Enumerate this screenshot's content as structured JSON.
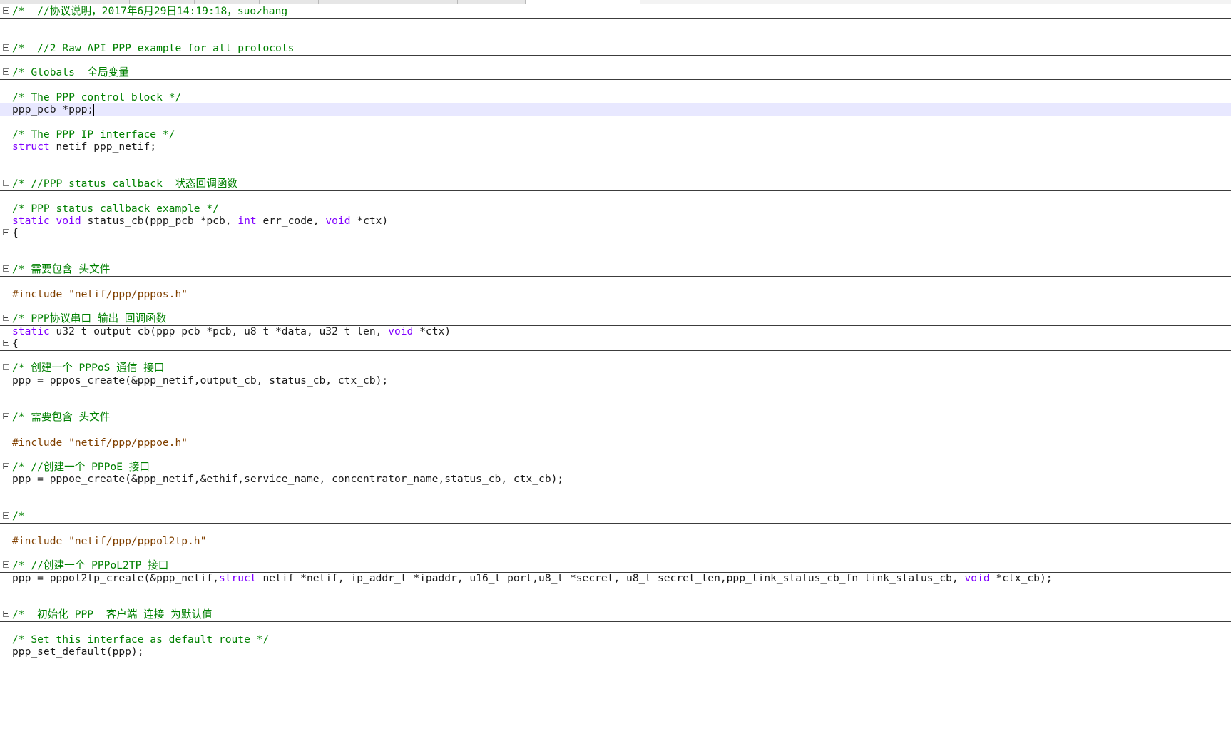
{
  "colors": {
    "comment": "#008000",
    "keyword": "#8000ff",
    "preprocessor": "#804000",
    "text": "#1a1a1a",
    "current_line": "#e8e8ff"
  },
  "icons": {
    "fold": "fold-expand-icon"
  },
  "editor": {
    "lines": [
      {
        "fold": true,
        "folded": true,
        "tokens": [
          {
            "t": "comment",
            "v": "/*  //协议说明，2017年6月29日14:19:18，suozhang"
          }
        ]
      },
      {
        "fold": true,
        "folded": true,
        "tokens": [
          {
            "t": "comment",
            "v": "/*  //2 Raw API PPP example for all protocols"
          }
        ]
      },
      {
        "fold": true,
        "folded": true,
        "tokens": [
          {
            "t": "comment",
            "v": "/* Globals  全局变量"
          }
        ]
      },
      {
        "tokens": [
          {
            "t": "comment",
            "v": "/* The PPP control block */"
          }
        ]
      },
      {
        "current": true,
        "tokens": [
          {
            "t": "plain",
            "v": "ppp_pcb *ppp;"
          }
        ]
      },
      {
        "tokens": [
          {
            "t": "comment",
            "v": "/* The PPP IP interface */"
          }
        ]
      },
      {
        "tokens": [
          {
            "t": "kw",
            "v": "struct"
          },
          {
            "t": "plain",
            "v": " netif ppp_netif;"
          }
        ]
      },
      {
        "fold": true,
        "folded": true,
        "tokens": [
          {
            "t": "comment",
            "v": "/* //PPP status callback  状态回调函数"
          }
        ]
      },
      {
        "tokens": [
          {
            "t": "comment",
            "v": "/* PPP status callback example */"
          }
        ]
      },
      {
        "tokens": [
          {
            "t": "kw",
            "v": "static"
          },
          {
            "t": "plain",
            "v": " "
          },
          {
            "t": "kw",
            "v": "void"
          },
          {
            "t": "plain",
            "v": " status_cb(ppp_pcb *pcb, "
          },
          {
            "t": "kw",
            "v": "int"
          },
          {
            "t": "plain",
            "v": " err_code, "
          },
          {
            "t": "kw",
            "v": "void"
          },
          {
            "t": "plain",
            "v": " *ctx)"
          }
        ]
      },
      {
        "fold": true,
        "folded": true,
        "tokens": [
          {
            "t": "plain",
            "v": "{"
          }
        ]
      },
      {
        "fold": true,
        "folded": true,
        "tokens": [
          {
            "t": "comment",
            "v": "/* 需要包含 头文件"
          }
        ]
      },
      {
        "tokens": [
          {
            "t": "pre",
            "v": "#include \"netif/ppp/pppos.h\""
          }
        ]
      },
      {
        "fold": true,
        "folded": true,
        "tokens": [
          {
            "t": "comment",
            "v": "/* PPP协议串口 输出 回调函数"
          }
        ]
      },
      {
        "tokens": [
          {
            "t": "kw",
            "v": "static"
          },
          {
            "t": "plain",
            "v": " u32_t output_cb(ppp_pcb *pcb, u8_t *data, u32_t len, "
          },
          {
            "t": "kw",
            "v": "void"
          },
          {
            "t": "plain",
            "v": " *ctx)"
          }
        ]
      },
      {
        "fold": true,
        "folded": true,
        "tokens": [
          {
            "t": "plain",
            "v": "{"
          }
        ]
      },
      {
        "fold": true,
        "folded": false,
        "tokens": [
          {
            "t": "comment",
            "v": "/* 创建一个 PPPoS 通信 接口"
          }
        ]
      },
      {
        "tokens": [
          {
            "t": "plain",
            "v": "ppp = pppos_create(&ppp_netif,output_cb, status_cb, ctx_cb);"
          }
        ]
      },
      {
        "fold": true,
        "folded": true,
        "tokens": [
          {
            "t": "comment",
            "v": "/* 需要包含 头文件"
          }
        ]
      },
      {
        "tokens": [
          {
            "t": "pre",
            "v": "#include \"netif/ppp/pppoe.h\""
          }
        ]
      },
      {
        "fold": true,
        "folded": true,
        "tokens": [
          {
            "t": "comment",
            "v": "/* //创建一个 PPPoE 接口"
          }
        ]
      },
      {
        "tokens": [
          {
            "t": "plain",
            "v": "ppp = pppoe_create(&ppp_netif,&ethif,service_name, concentrator_name,status_cb, ctx_cb);"
          }
        ]
      },
      {
        "fold": true,
        "folded": true,
        "tokens": [
          {
            "t": "comment",
            "v": "/*"
          }
        ]
      },
      {
        "tokens": [
          {
            "t": "pre",
            "v": "#include \"netif/ppp/pppol2tp.h\""
          }
        ]
      },
      {
        "fold": true,
        "folded": true,
        "tokens": [
          {
            "t": "comment",
            "v": "/* //创建一个 PPPoL2TP 接口"
          }
        ]
      },
      {
        "tokens": [
          {
            "t": "plain",
            "v": "ppp = pppol2tp_create(&ppp_netif,"
          },
          {
            "t": "kw",
            "v": "struct"
          },
          {
            "t": "plain",
            "v": " netif *netif, ip_addr_t *ipaddr, u16_t port,u8_t *secret, u8_t secret_len,ppp_link_status_cb_fn link_status_cb, "
          },
          {
            "t": "kw",
            "v": "void"
          },
          {
            "t": "plain",
            "v": " *ctx_cb);"
          }
        ]
      },
      {
        "fold": true,
        "folded": true,
        "tokens": [
          {
            "t": "comment",
            "v": "/*  初始化 PPP  客户端 连接 为默认值"
          }
        ]
      },
      {
        "tokens": [
          {
            "t": "comment",
            "v": "/* Set this interface as default route */"
          }
        ]
      },
      {
        "tokens": [
          {
            "t": "plain",
            "v": "ppp_set_default(ppp);"
          }
        ]
      }
    ]
  }
}
